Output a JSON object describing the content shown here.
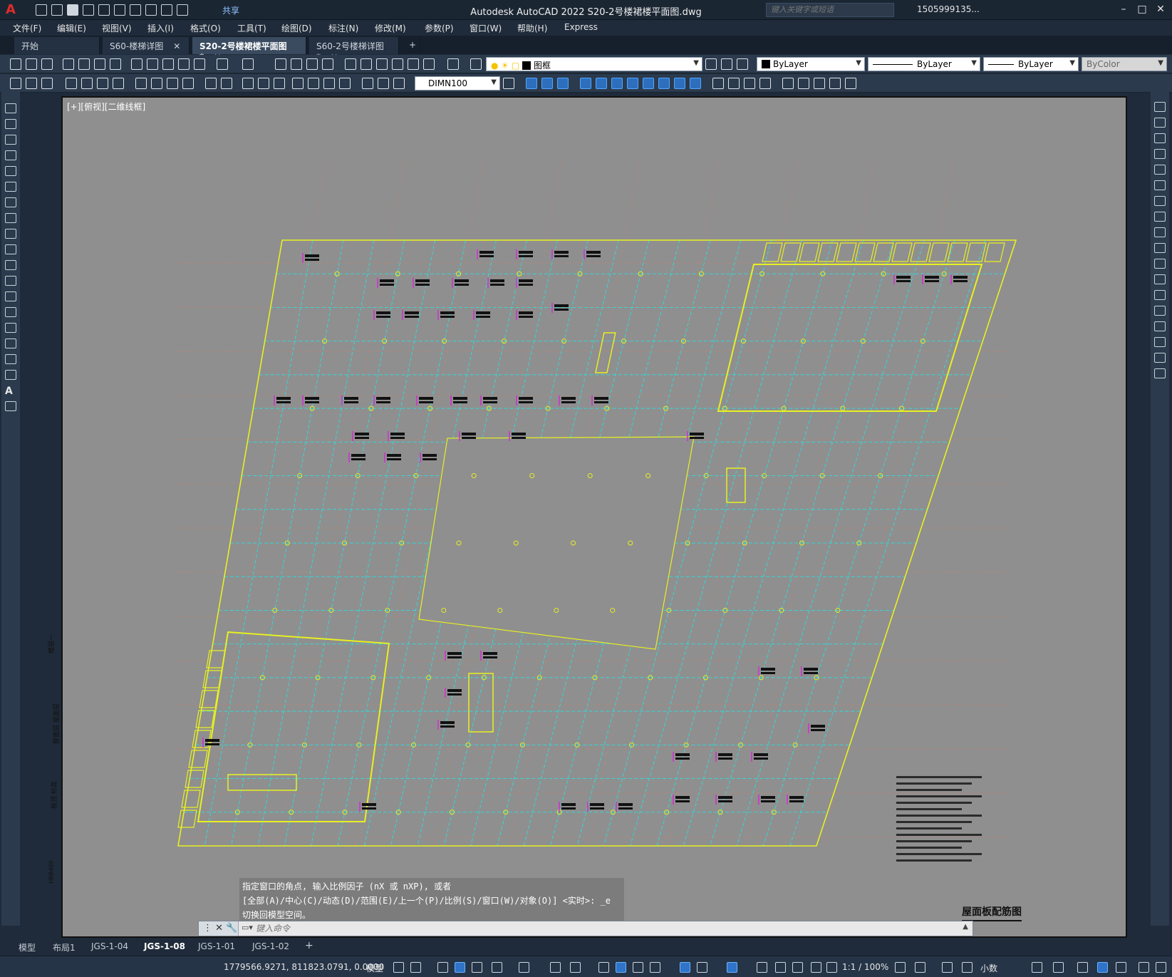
{
  "app": {
    "title": "Autodesk AutoCAD 2022    S20-2号楼裙楼平面图.dwg",
    "logo": "A",
    "share_label": "共享",
    "search_placeholder": "键入关键字或短语",
    "user_name": "1505999135...",
    "window_buttons": [
      "–",
      "□",
      "✕"
    ]
  },
  "menu": [
    "文件(F)",
    "编辑(E)",
    "视图(V)",
    "插入(I)",
    "格式(O)",
    "工具(T)",
    "绘图(D)",
    "标注(N)",
    "修改(M)",
    "参数(P)",
    "窗口(W)",
    "帮助(H)",
    "Express"
  ],
  "doc_tabs": [
    {
      "label": "开始",
      "active": false,
      "closable": false
    },
    {
      "label": "S60-楼梯详图",
      "active": false,
      "closable": true
    },
    {
      "label": "S20-2号楼裙楼平面图*",
      "active": true,
      "closable": true
    },
    {
      "label": "S60-2号楼梯详图*",
      "active": false,
      "closable": true
    }
  ],
  "properties": {
    "layer": "图框",
    "color": "ByLayer",
    "linetype": "ByLayer",
    "lineweight": "ByLayer",
    "plotstyle": "ByColor",
    "dimstyle": "DIMN100"
  },
  "viewport": {
    "label": "[+][俯视][二维线框]",
    "drawing_title": "屋面板配筋图",
    "left_annotations": [
      "楼层一",
      "屋面层 屋面层",
      "板顶 标高",
      "HRB400"
    ]
  },
  "command": {
    "history": [
      "指定窗口的角点, 输入比例因子 (nX 或 nXP), 或者",
      "[全部(A)/中心(C)/动态(D)/范围(E)/上一个(P)/比例(S)/窗口(W)/对象(O)] <实时>: _e",
      "切换回模型空间。"
    ],
    "placeholder": "键入命令"
  },
  "layout_tabs": [
    {
      "label": "模型",
      "active": false
    },
    {
      "label": "布局1",
      "active": false
    },
    {
      "label": "JGS-1-04",
      "active": false
    },
    {
      "label": "JGS-1-08",
      "active": true
    },
    {
      "label": "JGS-1-01",
      "active": false
    },
    {
      "label": "JGS-1-02",
      "active": false
    },
    {
      "label": "+",
      "active": false
    }
  ],
  "status": {
    "coordinates": "1779566.9271, 811823.0791, 0.0000",
    "space": "模型",
    "annotation_scale": "1:1 / 100%",
    "units": "小数"
  },
  "colors": {
    "background": "#8f8f8f",
    "grid_lines": "#36d6d6",
    "outline": "#e8f020",
    "rebar_labels": "#111111",
    "rebar_ticks": "#d22bd2",
    "axis_lines": "#d4806a"
  }
}
